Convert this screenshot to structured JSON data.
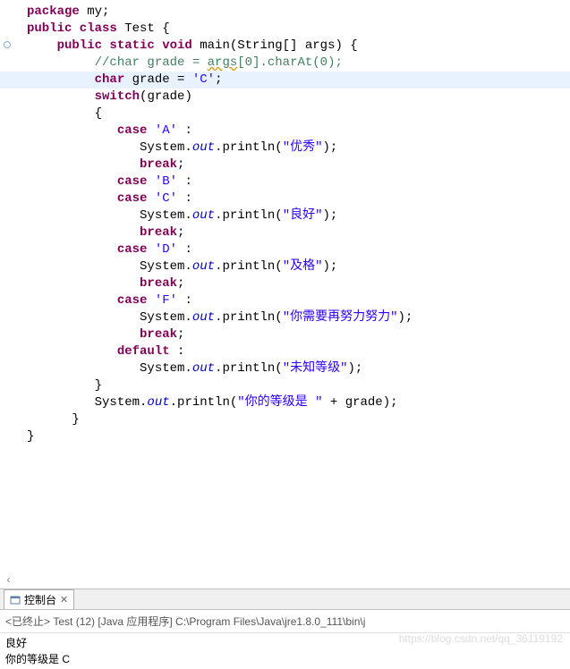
{
  "code": {
    "lines": [
      {
        "tokens": [
          {
            "t": "package",
            "c": "kw"
          },
          {
            "t": " my;",
            "c": "plain"
          }
        ]
      },
      {
        "tokens": [
          {
            "t": "public class",
            "c": "kw"
          },
          {
            "t": " Test {",
            "c": "plain"
          }
        ]
      },
      {
        "gutter": "circle",
        "tokens": [
          {
            "t": "    ",
            "c": "plain"
          },
          {
            "t": "public static void",
            "c": "kw"
          },
          {
            "t": " main(String[] args) {",
            "c": "plain"
          }
        ]
      },
      {
        "tokens": [
          {
            "t": "         ",
            "c": "plain"
          },
          {
            "t": "//char grade = ",
            "c": "comment"
          },
          {
            "t": "args",
            "c": "comment underline"
          },
          {
            "t": "[0].charAt(0);",
            "c": "comment"
          }
        ]
      },
      {
        "highlight": true,
        "tokens": [
          {
            "t": "         ",
            "c": "plain"
          },
          {
            "t": "char",
            "c": "kw"
          },
          {
            "t": " grade = ",
            "c": "plain"
          },
          {
            "t": "'C'",
            "c": "str"
          },
          {
            "t": ";",
            "c": "plain"
          }
        ]
      },
      {
        "tokens": [
          {
            "t": "         ",
            "c": "plain"
          },
          {
            "t": "switch",
            "c": "kw"
          },
          {
            "t": "(grade)",
            "c": "plain"
          }
        ]
      },
      {
        "tokens": [
          {
            "t": "         {",
            "c": "plain"
          }
        ]
      },
      {
        "tokens": [
          {
            "t": "            ",
            "c": "plain"
          },
          {
            "t": "case",
            "c": "kw"
          },
          {
            "t": " ",
            "c": "plain"
          },
          {
            "t": "'A'",
            "c": "str"
          },
          {
            "t": " :",
            "c": "plain"
          }
        ]
      },
      {
        "tokens": [
          {
            "t": "               System.",
            "c": "plain"
          },
          {
            "t": "out",
            "c": "field"
          },
          {
            "t": ".println(",
            "c": "plain"
          },
          {
            "t": "\"优秀\"",
            "c": "str"
          },
          {
            "t": ");",
            "c": "plain"
          }
        ]
      },
      {
        "tokens": [
          {
            "t": "               ",
            "c": "plain"
          },
          {
            "t": "break",
            "c": "kw"
          },
          {
            "t": ";",
            "c": "plain"
          }
        ]
      },
      {
        "tokens": [
          {
            "t": "            ",
            "c": "plain"
          },
          {
            "t": "case",
            "c": "kw"
          },
          {
            "t": " ",
            "c": "plain"
          },
          {
            "t": "'B'",
            "c": "str"
          },
          {
            "t": " :",
            "c": "plain"
          }
        ]
      },
      {
        "tokens": [
          {
            "t": "            ",
            "c": "plain"
          },
          {
            "t": "case",
            "c": "kw"
          },
          {
            "t": " ",
            "c": "plain"
          },
          {
            "t": "'C'",
            "c": "str"
          },
          {
            "t": " :",
            "c": "plain"
          }
        ]
      },
      {
        "tokens": [
          {
            "t": "               System.",
            "c": "plain"
          },
          {
            "t": "out",
            "c": "field"
          },
          {
            "t": ".println(",
            "c": "plain"
          },
          {
            "t": "\"良好\"",
            "c": "str"
          },
          {
            "t": ");",
            "c": "plain"
          }
        ]
      },
      {
        "tokens": [
          {
            "t": "               ",
            "c": "plain"
          },
          {
            "t": "break",
            "c": "kw"
          },
          {
            "t": ";",
            "c": "plain"
          }
        ]
      },
      {
        "tokens": [
          {
            "t": "            ",
            "c": "plain"
          },
          {
            "t": "case",
            "c": "kw"
          },
          {
            "t": " ",
            "c": "plain"
          },
          {
            "t": "'D'",
            "c": "str"
          },
          {
            "t": " :",
            "c": "plain"
          }
        ]
      },
      {
        "tokens": [
          {
            "t": "               System.",
            "c": "plain"
          },
          {
            "t": "out",
            "c": "field"
          },
          {
            "t": ".println(",
            "c": "plain"
          },
          {
            "t": "\"及格\"",
            "c": "str"
          },
          {
            "t": ");",
            "c": "plain"
          }
        ]
      },
      {
        "tokens": [
          {
            "t": "               ",
            "c": "plain"
          },
          {
            "t": "break",
            "c": "kw"
          },
          {
            "t": ";",
            "c": "plain"
          }
        ]
      },
      {
        "tokens": [
          {
            "t": "            ",
            "c": "plain"
          },
          {
            "t": "case",
            "c": "kw"
          },
          {
            "t": " ",
            "c": "plain"
          },
          {
            "t": "'F'",
            "c": "str"
          },
          {
            "t": " :",
            "c": "plain"
          }
        ]
      },
      {
        "tokens": [
          {
            "t": "               System.",
            "c": "plain"
          },
          {
            "t": "out",
            "c": "field"
          },
          {
            "t": ".println(",
            "c": "plain"
          },
          {
            "t": "\"你需要再努力努力\"",
            "c": "str"
          },
          {
            "t": ");",
            "c": "plain"
          }
        ]
      },
      {
        "tokens": [
          {
            "t": "               ",
            "c": "plain"
          },
          {
            "t": "break",
            "c": "kw"
          },
          {
            "t": ";",
            "c": "plain"
          }
        ]
      },
      {
        "tokens": [
          {
            "t": "            ",
            "c": "plain"
          },
          {
            "t": "default",
            "c": "kw"
          },
          {
            "t": " :",
            "c": "plain"
          }
        ]
      },
      {
        "tokens": [
          {
            "t": "               System.",
            "c": "plain"
          },
          {
            "t": "out",
            "c": "field"
          },
          {
            "t": ".println(",
            "c": "plain"
          },
          {
            "t": "\"未知等级\"",
            "c": "str"
          },
          {
            "t": ");",
            "c": "plain"
          }
        ]
      },
      {
        "tokens": [
          {
            "t": "         }",
            "c": "plain"
          }
        ]
      },
      {
        "tokens": [
          {
            "t": "         System.",
            "c": "plain"
          },
          {
            "t": "out",
            "c": "field"
          },
          {
            "t": ".println(",
            "c": "plain"
          },
          {
            "t": "\"你的等级是 \"",
            "c": "str"
          },
          {
            "t": " + grade);",
            "c": "plain"
          }
        ]
      },
      {
        "tokens": [
          {
            "t": "      }",
            "c": "plain"
          }
        ]
      },
      {
        "tokens": [
          {
            "t": "",
            "c": "plain"
          }
        ]
      },
      {
        "tokens": [
          {
            "t": "}",
            "c": "plain"
          }
        ]
      }
    ]
  },
  "console": {
    "tab_label": "控制台",
    "status": "<已终止> Test (12) [Java 应用程序] C:\\Program Files\\Java\\jre1.8.0_111\\bin\\j",
    "output": [
      "良好",
      "你的等级是 C"
    ]
  },
  "watermark": "https://blog.csdn.net/qq_36119192"
}
